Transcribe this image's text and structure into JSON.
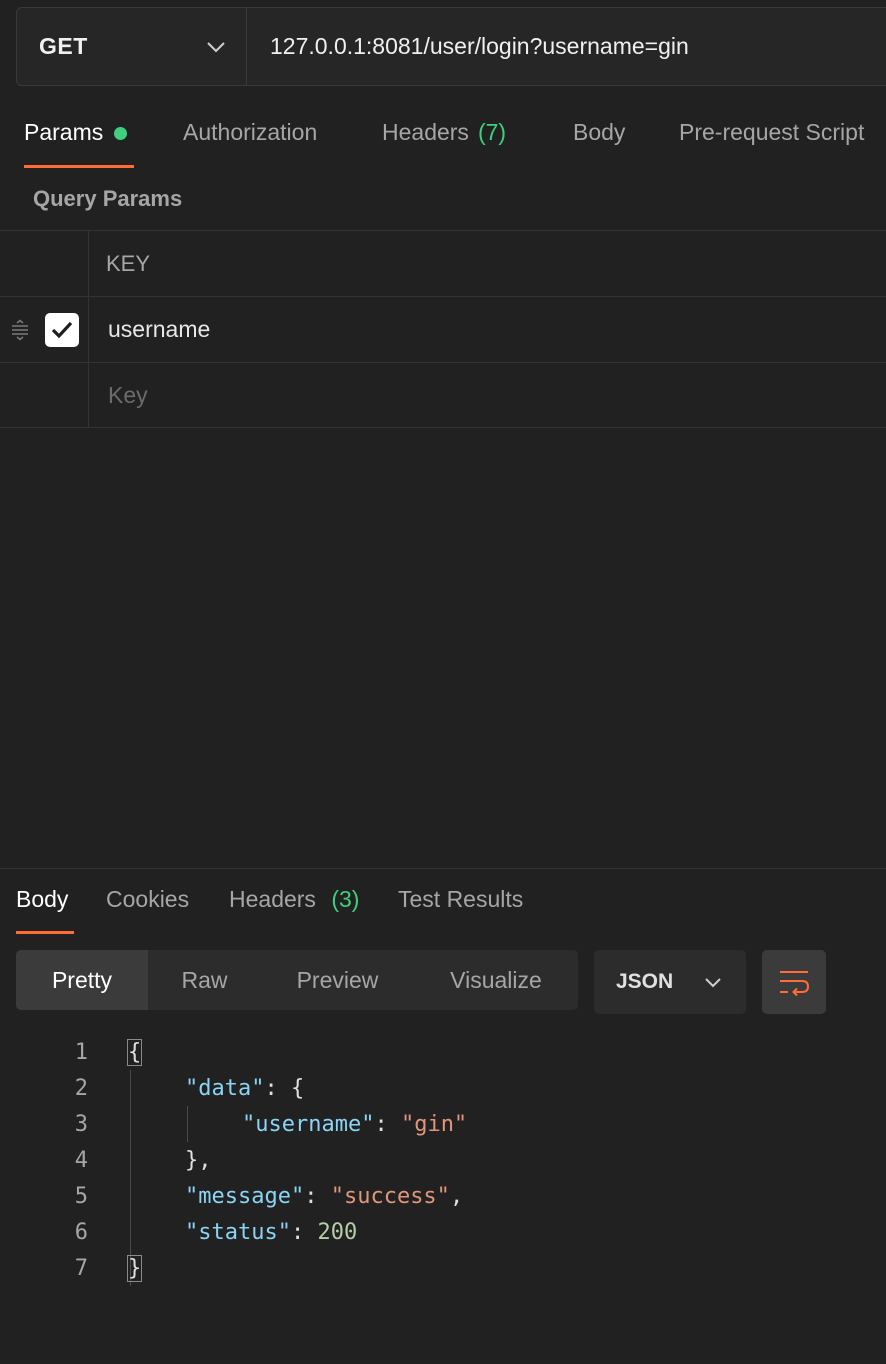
{
  "request": {
    "method": "GET",
    "url": "127.0.0.1:8081/user/login?username=gin"
  },
  "request_tabs": [
    {
      "label": "Params",
      "active": true,
      "dot": true
    },
    {
      "label": "Authorization"
    },
    {
      "label": "Headers",
      "count": "(7)"
    },
    {
      "label": "Body"
    },
    {
      "label": "Pre-request Script"
    }
  ],
  "query_params": {
    "title": "Query Params",
    "column_key": "KEY",
    "rows": [
      {
        "key": "username",
        "checked": true
      }
    ],
    "key_placeholder": "Key"
  },
  "response_tabs": [
    {
      "label": "Body",
      "active": true
    },
    {
      "label": "Cookies"
    },
    {
      "label": "Headers",
      "count": "(3)"
    },
    {
      "label": "Test Results"
    }
  ],
  "view_modes": [
    {
      "label": "Pretty",
      "active": true
    },
    {
      "label": "Raw"
    },
    {
      "label": "Preview"
    },
    {
      "label": "Visualize"
    }
  ],
  "format": "JSON",
  "code": {
    "line_numbers": [
      "1",
      "2",
      "3",
      "4",
      "5",
      "6",
      "7"
    ],
    "lines": [
      {
        "indent": 0,
        "tokens": [
          {
            "t": "{",
            "c": "p",
            "box": true
          }
        ]
      },
      {
        "indent": 1,
        "tokens": [
          {
            "t": "\"data\"",
            "c": "k"
          },
          {
            "t": ": {",
            "c": "p"
          }
        ]
      },
      {
        "indent": 2,
        "tokens": [
          {
            "t": "\"username\"",
            "c": "k"
          },
          {
            "t": ": ",
            "c": "p"
          },
          {
            "t": "\"gin\"",
            "c": "s"
          }
        ]
      },
      {
        "indent": 1,
        "tokens": [
          {
            "t": "},",
            "c": "p"
          }
        ]
      },
      {
        "indent": 1,
        "tokens": [
          {
            "t": "\"message\"",
            "c": "k"
          },
          {
            "t": ": ",
            "c": "p"
          },
          {
            "t": "\"success\"",
            "c": "s"
          },
          {
            "t": ",",
            "c": "p"
          }
        ]
      },
      {
        "indent": 1,
        "tokens": [
          {
            "t": "\"status\"",
            "c": "k"
          },
          {
            "t": ": ",
            "c": "p"
          },
          {
            "t": "200",
            "c": "n"
          }
        ]
      },
      {
        "indent": 0,
        "tokens": [
          {
            "t": "}",
            "c": "p",
            "box": true
          }
        ]
      }
    ]
  },
  "colors": {
    "accent": "#ff6c37",
    "success": "#3fcf7d",
    "json_key": "#8ad4f5",
    "json_string": "#e0967a",
    "json_number": "#b5cea8"
  }
}
